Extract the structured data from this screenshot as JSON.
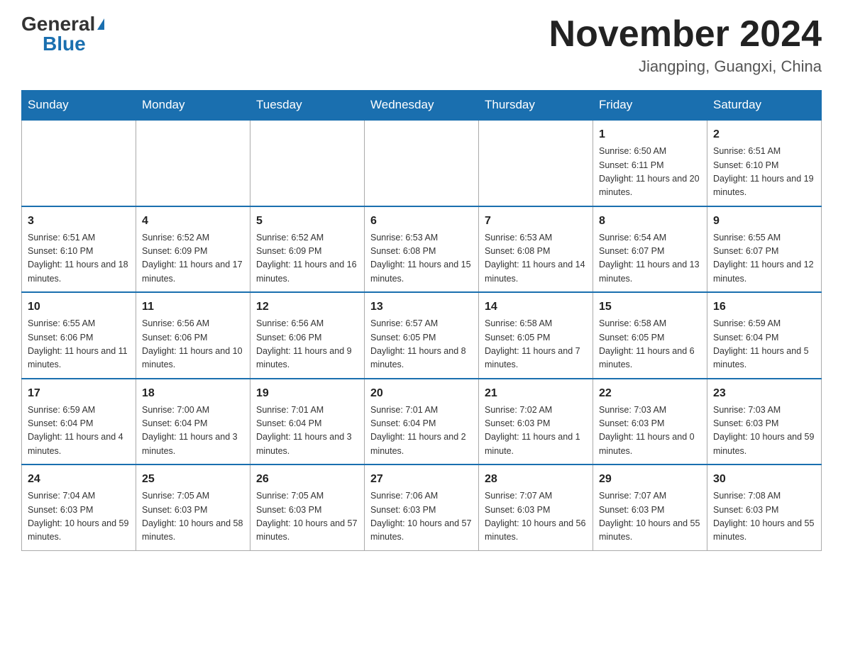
{
  "header": {
    "logo_general": "General",
    "logo_blue": "Blue",
    "month_title": "November 2024",
    "location": "Jiangping, Guangxi, China"
  },
  "days_of_week": [
    "Sunday",
    "Monday",
    "Tuesday",
    "Wednesday",
    "Thursday",
    "Friday",
    "Saturday"
  ],
  "weeks": [
    [
      {
        "day": "",
        "info": ""
      },
      {
        "day": "",
        "info": ""
      },
      {
        "day": "",
        "info": ""
      },
      {
        "day": "",
        "info": ""
      },
      {
        "day": "",
        "info": ""
      },
      {
        "day": "1",
        "info": "Sunrise: 6:50 AM\nSunset: 6:11 PM\nDaylight: 11 hours and 20 minutes."
      },
      {
        "day": "2",
        "info": "Sunrise: 6:51 AM\nSunset: 6:10 PM\nDaylight: 11 hours and 19 minutes."
      }
    ],
    [
      {
        "day": "3",
        "info": "Sunrise: 6:51 AM\nSunset: 6:10 PM\nDaylight: 11 hours and 18 minutes."
      },
      {
        "day": "4",
        "info": "Sunrise: 6:52 AM\nSunset: 6:09 PM\nDaylight: 11 hours and 17 minutes."
      },
      {
        "day": "5",
        "info": "Sunrise: 6:52 AM\nSunset: 6:09 PM\nDaylight: 11 hours and 16 minutes."
      },
      {
        "day": "6",
        "info": "Sunrise: 6:53 AM\nSunset: 6:08 PM\nDaylight: 11 hours and 15 minutes."
      },
      {
        "day": "7",
        "info": "Sunrise: 6:53 AM\nSunset: 6:08 PM\nDaylight: 11 hours and 14 minutes."
      },
      {
        "day": "8",
        "info": "Sunrise: 6:54 AM\nSunset: 6:07 PM\nDaylight: 11 hours and 13 minutes."
      },
      {
        "day": "9",
        "info": "Sunrise: 6:55 AM\nSunset: 6:07 PM\nDaylight: 11 hours and 12 minutes."
      }
    ],
    [
      {
        "day": "10",
        "info": "Sunrise: 6:55 AM\nSunset: 6:06 PM\nDaylight: 11 hours and 11 minutes."
      },
      {
        "day": "11",
        "info": "Sunrise: 6:56 AM\nSunset: 6:06 PM\nDaylight: 11 hours and 10 minutes."
      },
      {
        "day": "12",
        "info": "Sunrise: 6:56 AM\nSunset: 6:06 PM\nDaylight: 11 hours and 9 minutes."
      },
      {
        "day": "13",
        "info": "Sunrise: 6:57 AM\nSunset: 6:05 PM\nDaylight: 11 hours and 8 minutes."
      },
      {
        "day": "14",
        "info": "Sunrise: 6:58 AM\nSunset: 6:05 PM\nDaylight: 11 hours and 7 minutes."
      },
      {
        "day": "15",
        "info": "Sunrise: 6:58 AM\nSunset: 6:05 PM\nDaylight: 11 hours and 6 minutes."
      },
      {
        "day": "16",
        "info": "Sunrise: 6:59 AM\nSunset: 6:04 PM\nDaylight: 11 hours and 5 minutes."
      }
    ],
    [
      {
        "day": "17",
        "info": "Sunrise: 6:59 AM\nSunset: 6:04 PM\nDaylight: 11 hours and 4 minutes."
      },
      {
        "day": "18",
        "info": "Sunrise: 7:00 AM\nSunset: 6:04 PM\nDaylight: 11 hours and 3 minutes."
      },
      {
        "day": "19",
        "info": "Sunrise: 7:01 AM\nSunset: 6:04 PM\nDaylight: 11 hours and 3 minutes."
      },
      {
        "day": "20",
        "info": "Sunrise: 7:01 AM\nSunset: 6:04 PM\nDaylight: 11 hours and 2 minutes."
      },
      {
        "day": "21",
        "info": "Sunrise: 7:02 AM\nSunset: 6:03 PM\nDaylight: 11 hours and 1 minute."
      },
      {
        "day": "22",
        "info": "Sunrise: 7:03 AM\nSunset: 6:03 PM\nDaylight: 11 hours and 0 minutes."
      },
      {
        "day": "23",
        "info": "Sunrise: 7:03 AM\nSunset: 6:03 PM\nDaylight: 10 hours and 59 minutes."
      }
    ],
    [
      {
        "day": "24",
        "info": "Sunrise: 7:04 AM\nSunset: 6:03 PM\nDaylight: 10 hours and 59 minutes."
      },
      {
        "day": "25",
        "info": "Sunrise: 7:05 AM\nSunset: 6:03 PM\nDaylight: 10 hours and 58 minutes."
      },
      {
        "day": "26",
        "info": "Sunrise: 7:05 AM\nSunset: 6:03 PM\nDaylight: 10 hours and 57 minutes."
      },
      {
        "day": "27",
        "info": "Sunrise: 7:06 AM\nSunset: 6:03 PM\nDaylight: 10 hours and 57 minutes."
      },
      {
        "day": "28",
        "info": "Sunrise: 7:07 AM\nSunset: 6:03 PM\nDaylight: 10 hours and 56 minutes."
      },
      {
        "day": "29",
        "info": "Sunrise: 7:07 AM\nSunset: 6:03 PM\nDaylight: 10 hours and 55 minutes."
      },
      {
        "day": "30",
        "info": "Sunrise: 7:08 AM\nSunset: 6:03 PM\nDaylight: 10 hours and 55 minutes."
      }
    ]
  ]
}
